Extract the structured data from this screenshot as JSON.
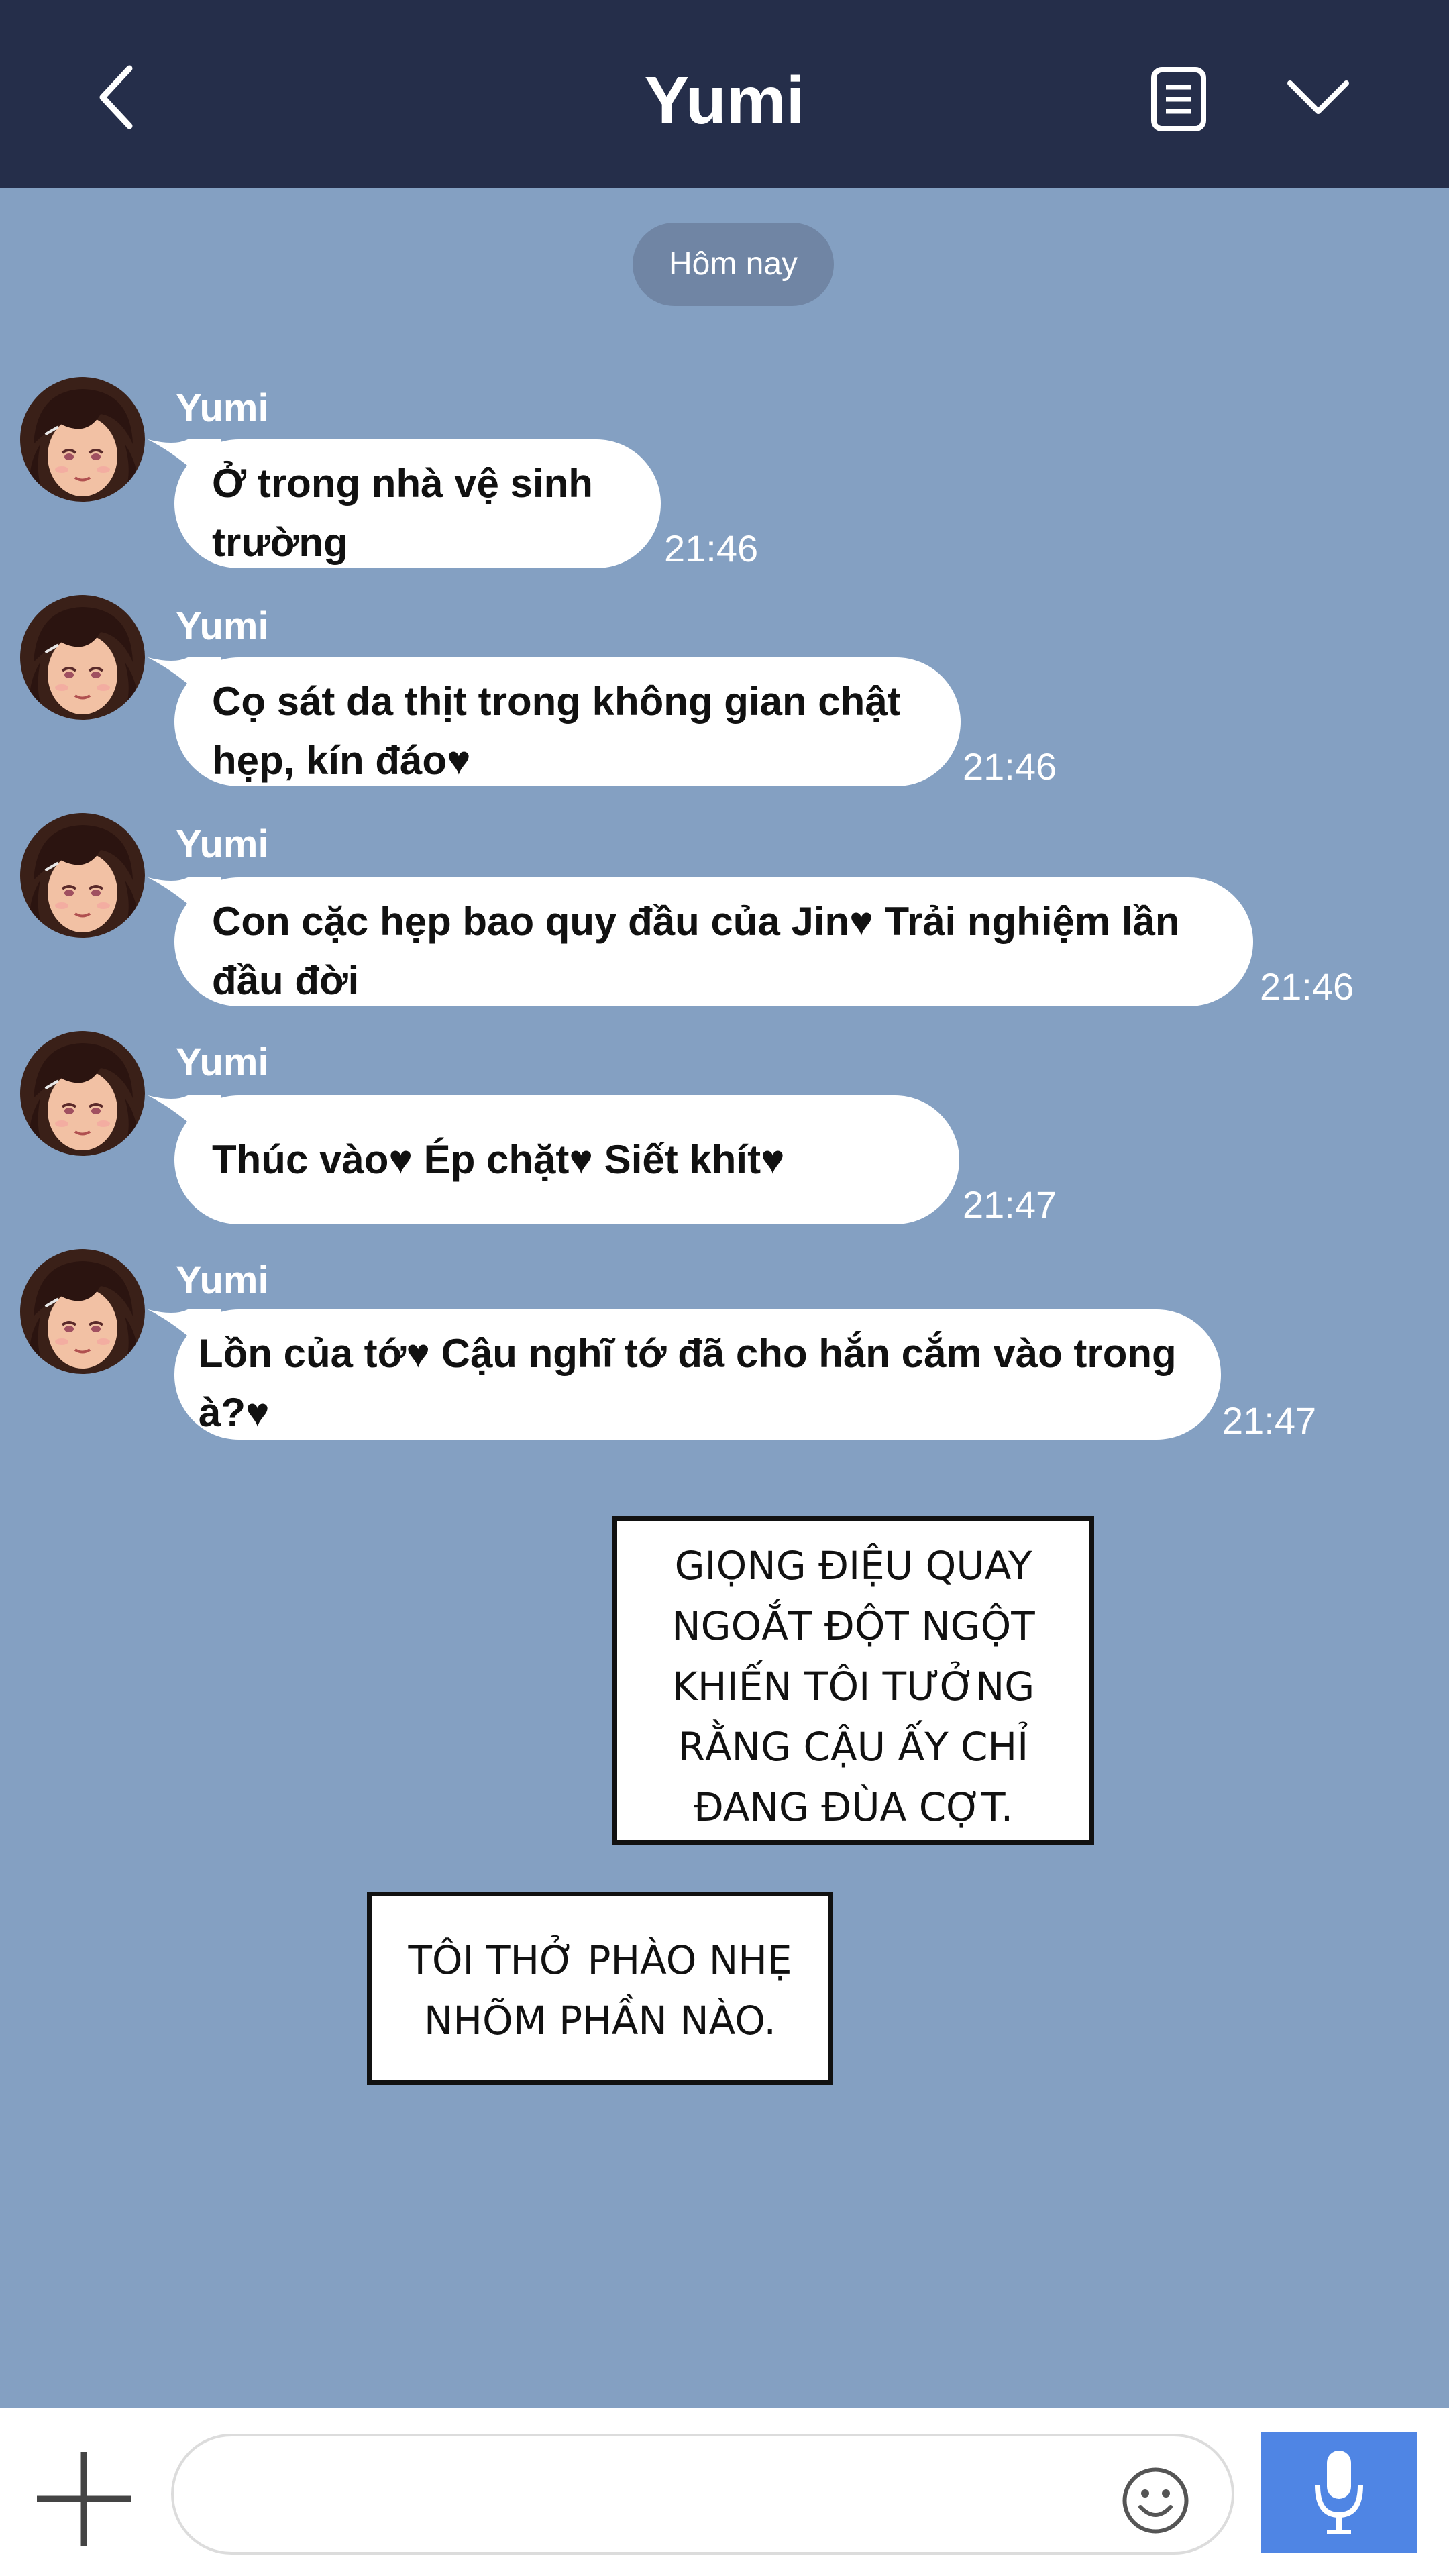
{
  "header": {
    "title": "Yumi"
  },
  "date_separator": "Hôm nay",
  "messages": [
    {
      "sender": "Yumi",
      "text": "Ở trong nhà vệ sinh trường",
      "time": "21:46"
    },
    {
      "sender": "Yumi",
      "text": "Cọ sát da thịt trong không gian chật hẹp, kín đáo♥",
      "time": "21:46"
    },
    {
      "sender": "Yumi",
      "text": "Con cặc hẹp bao quy đầu của Jin♥ Trải nghiệm lần đầu đời",
      "time": "21:46"
    },
    {
      "sender": "Yumi",
      "text": "Thúc vào♥ Ép chặt♥ Siết khít♥",
      "time": "21:47"
    },
    {
      "sender": "Yumi",
      "text": "Lồn của tớ♥ Cậu nghĩ tớ đã cho hắn cắm vào trong à?♥",
      "time": "21:47"
    }
  ],
  "narration": [
    {
      "lines": [
        "GIỌNG ĐIỆU QUAY",
        "NGOẮT ĐỘT NGỘT",
        "KHIẾN TÔI TƯỞNG",
        "RẰNG CẬU ẤY CHỈ",
        "ĐANG ĐÙA CỢT."
      ]
    },
    {
      "lines": [
        "TÔI THỞ PHÀO NHẸ",
        "NHÕM PHẦN NÀO."
      ]
    }
  ],
  "input": {
    "value": "",
    "placeholder": ""
  },
  "icons": {
    "back": "chevron-left-icon",
    "notes": "notes-icon",
    "dropdown": "chevron-down-icon",
    "plus": "plus-icon",
    "emoji": "smiley-icon",
    "mic": "microphone-icon"
  },
  "colors": {
    "header_bg": "#252e4a",
    "chat_bg": "#84a0c2",
    "date_pill": "#7085a4",
    "bubble": "#ffffff",
    "mic_button": "#4f85e4"
  }
}
